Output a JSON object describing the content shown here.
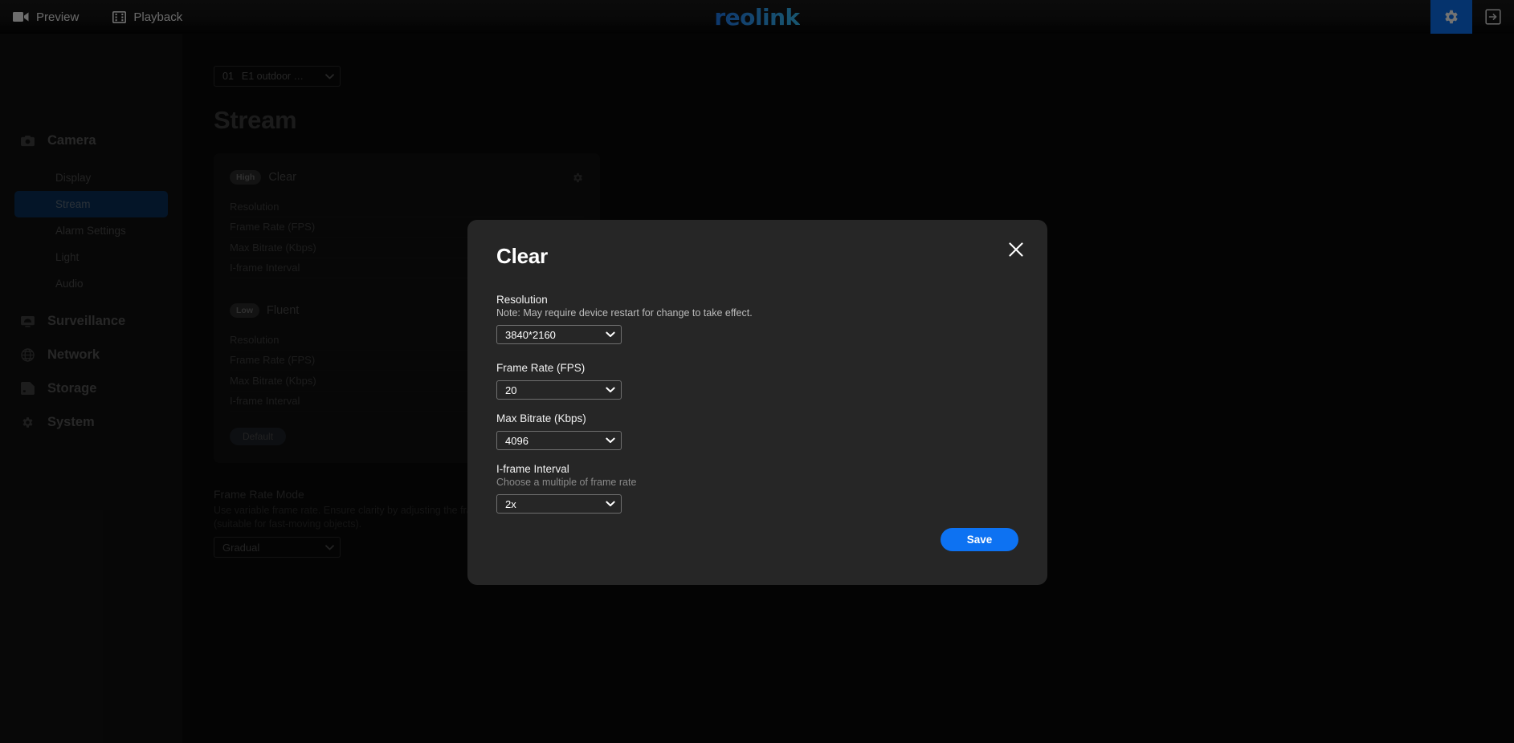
{
  "topbar": {
    "tabs": [
      {
        "label": "Preview",
        "icon": "camcorder-icon"
      },
      {
        "label": "Playback",
        "icon": "film-strip-icon"
      }
    ],
    "logo": "reolink",
    "settings_icon": "gear-icon",
    "logout_icon": "logout-arrow-icon",
    "accent": "#0d72f2"
  },
  "sidebar": {
    "groups": [
      {
        "label": "Camera",
        "icon": "camera-icon",
        "items": [
          {
            "label": "Display",
            "active": false
          },
          {
            "label": "Stream",
            "active": true
          },
          {
            "label": "Alarm Settings",
            "active": false
          },
          {
            "label": "Light",
            "active": false
          },
          {
            "label": "Audio",
            "active": false
          }
        ]
      },
      {
        "label": "Surveillance",
        "icon": "monitor-icon",
        "items": []
      },
      {
        "label": "Network",
        "icon": "globe-icon",
        "items": []
      },
      {
        "label": "Storage",
        "icon": "sdcard-icon",
        "items": []
      },
      {
        "label": "System",
        "icon": "gear-icon",
        "items": []
      }
    ],
    "active_highlight": "#0b3059"
  },
  "main": {
    "camera_selector": {
      "number": "01",
      "name": "E1 outdoor …"
    },
    "page_title": "Stream",
    "streams": [
      {
        "badge": "High",
        "title": "Clear",
        "gear_icon": "gear-icon",
        "rows": [
          "Resolution",
          "Frame Rate (FPS)",
          "Max Bitrate (Kbps)",
          "I-frame Interval"
        ]
      },
      {
        "badge": "Low",
        "title": "Fluent",
        "rows": [
          "Resolution",
          "Frame Rate (FPS)",
          "Max Bitrate (Kbps)",
          "I-frame Interval"
        ]
      }
    ],
    "default_button": "Default",
    "frame_rate_mode": {
      "label": "Frame Rate Mode",
      "note": "Use variable frame rate. Ensure clarity by adjusting the frame rate in gradual steps (suitable for fast-moving objects).",
      "value": "Gradual"
    }
  },
  "modal": {
    "title": "Clear",
    "close_icon": "close-icon",
    "fields": [
      {
        "label": "Resolution",
        "note": "Note: May require device restart for change to take effect.",
        "note_dim": false,
        "value": "3840*2160"
      },
      {
        "label": "Frame Rate (FPS)",
        "note": "",
        "note_dim": false,
        "value": "20"
      },
      {
        "label": "Max Bitrate (Kbps)",
        "note": "",
        "note_dim": false,
        "value": "4096"
      },
      {
        "label": "I-frame Interval",
        "note": "Choose a multiple of frame rate",
        "note_dim": true,
        "value": "2x"
      }
    ],
    "save_label": "Save"
  }
}
